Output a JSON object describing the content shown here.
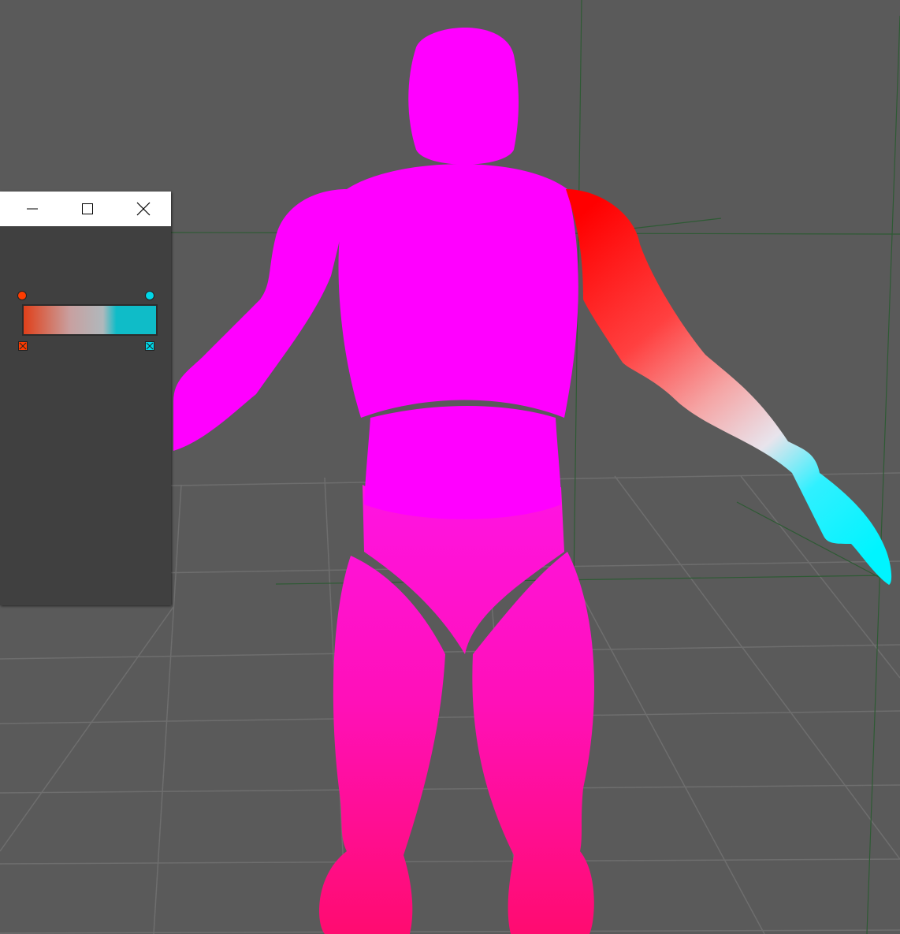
{
  "viewport": {
    "background": "#5a5a5a",
    "grid_color": "#6e6e6e",
    "axis_color": "#2e5a34"
  },
  "model": {
    "body_color": "#ff00ff",
    "legs_color": "#ff0f9c",
    "arm_gradient": [
      "#ff0000",
      "#f6a0a0",
      "#e8e8e8",
      "#00f0ff"
    ]
  },
  "gradient_window": {
    "buttons": {
      "minimize_icon": "minimize-icon",
      "maximize_icon": "maximize-icon",
      "close_icon": "close-icon"
    },
    "gradient_start_color": "#e0401a",
    "gradient_mid_color": "#c8a0a0",
    "gradient_end_color": "#0fbcc8",
    "stops": [
      {
        "color": "#ff3c00",
        "icon": "stop-handle-icon",
        "delete_icon": "delete-stop-icon"
      },
      {
        "color": "#00d8e8",
        "icon": "stop-handle-icon",
        "delete_icon": "delete-stop-icon"
      }
    ]
  }
}
